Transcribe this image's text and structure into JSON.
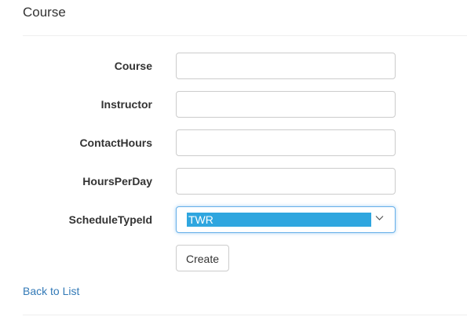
{
  "page": {
    "title": "Course"
  },
  "form": {
    "fields": [
      {
        "label": "Course",
        "value": "",
        "placeholder": ""
      },
      {
        "label": "Instructor",
        "value": "",
        "placeholder": ""
      },
      {
        "label": "ContactHours",
        "value": "",
        "placeholder": ""
      },
      {
        "label": "HoursPerDay",
        "value": "",
        "placeholder": ""
      }
    ],
    "schedule_type": {
      "label": "ScheduleTypeId",
      "selected": "TWR"
    },
    "submit_label": "Create"
  },
  "links": {
    "back_label": "Back to List"
  },
  "colors": {
    "link": "#337ab7",
    "select_highlight": "#2fa6df",
    "focus_border": "#66afe9"
  },
  "icons": {
    "select_arrow": "chevron-down-icon"
  }
}
